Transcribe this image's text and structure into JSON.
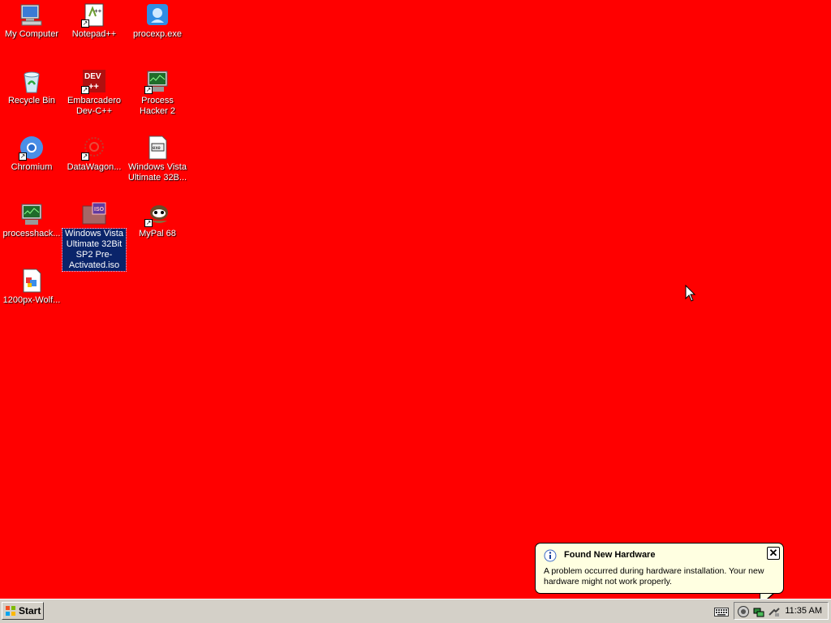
{
  "desktop": {
    "background_color": "#ff0000",
    "icons": [
      {
        "label": "My Computer",
        "icon": "my-computer-icon"
      },
      {
        "label": "Notepad++",
        "icon": "notepad-plus-plus-icon",
        "shortcut": true
      },
      {
        "label": "procexp.exe",
        "icon": "procexp-icon"
      },
      {
        "label": "Recycle Bin",
        "icon": "recycle-bin-icon"
      },
      {
        "label": "Embarcadero Dev-C++",
        "icon": "dev-cpp-icon",
        "shortcut": true
      },
      {
        "label": "Process Hacker 2",
        "icon": "process-hacker-icon",
        "shortcut": true
      },
      {
        "label": "Chromium",
        "icon": "chromium-icon",
        "shortcut": true
      },
      {
        "label": "DataWagon...",
        "icon": "datawagon-icon",
        "shortcut": true
      },
      {
        "label": "Windows Vista Ultimate 32B...",
        "icon": "vista-file-icon"
      },
      {
        "label": "processhack...",
        "icon": "processhacker-file-icon"
      },
      {
        "label": "Windows Vista Ultimate 32Bit SP2 Pre-Activated.iso",
        "icon": "iso-file-icon",
        "selected": true
      },
      {
        "label": "MyPal 68",
        "icon": "mypal-icon",
        "shortcut": true
      },
      {
        "label": "1200px-Wolf...",
        "icon": "image-file-icon"
      }
    ]
  },
  "taskbar": {
    "start_label": "Start",
    "clock": "11:35 AM"
  },
  "balloon": {
    "title": "Found New Hardware",
    "text": "A problem occurred during hardware installation. Your new hardware might not work properly.",
    "close": "✕"
  }
}
